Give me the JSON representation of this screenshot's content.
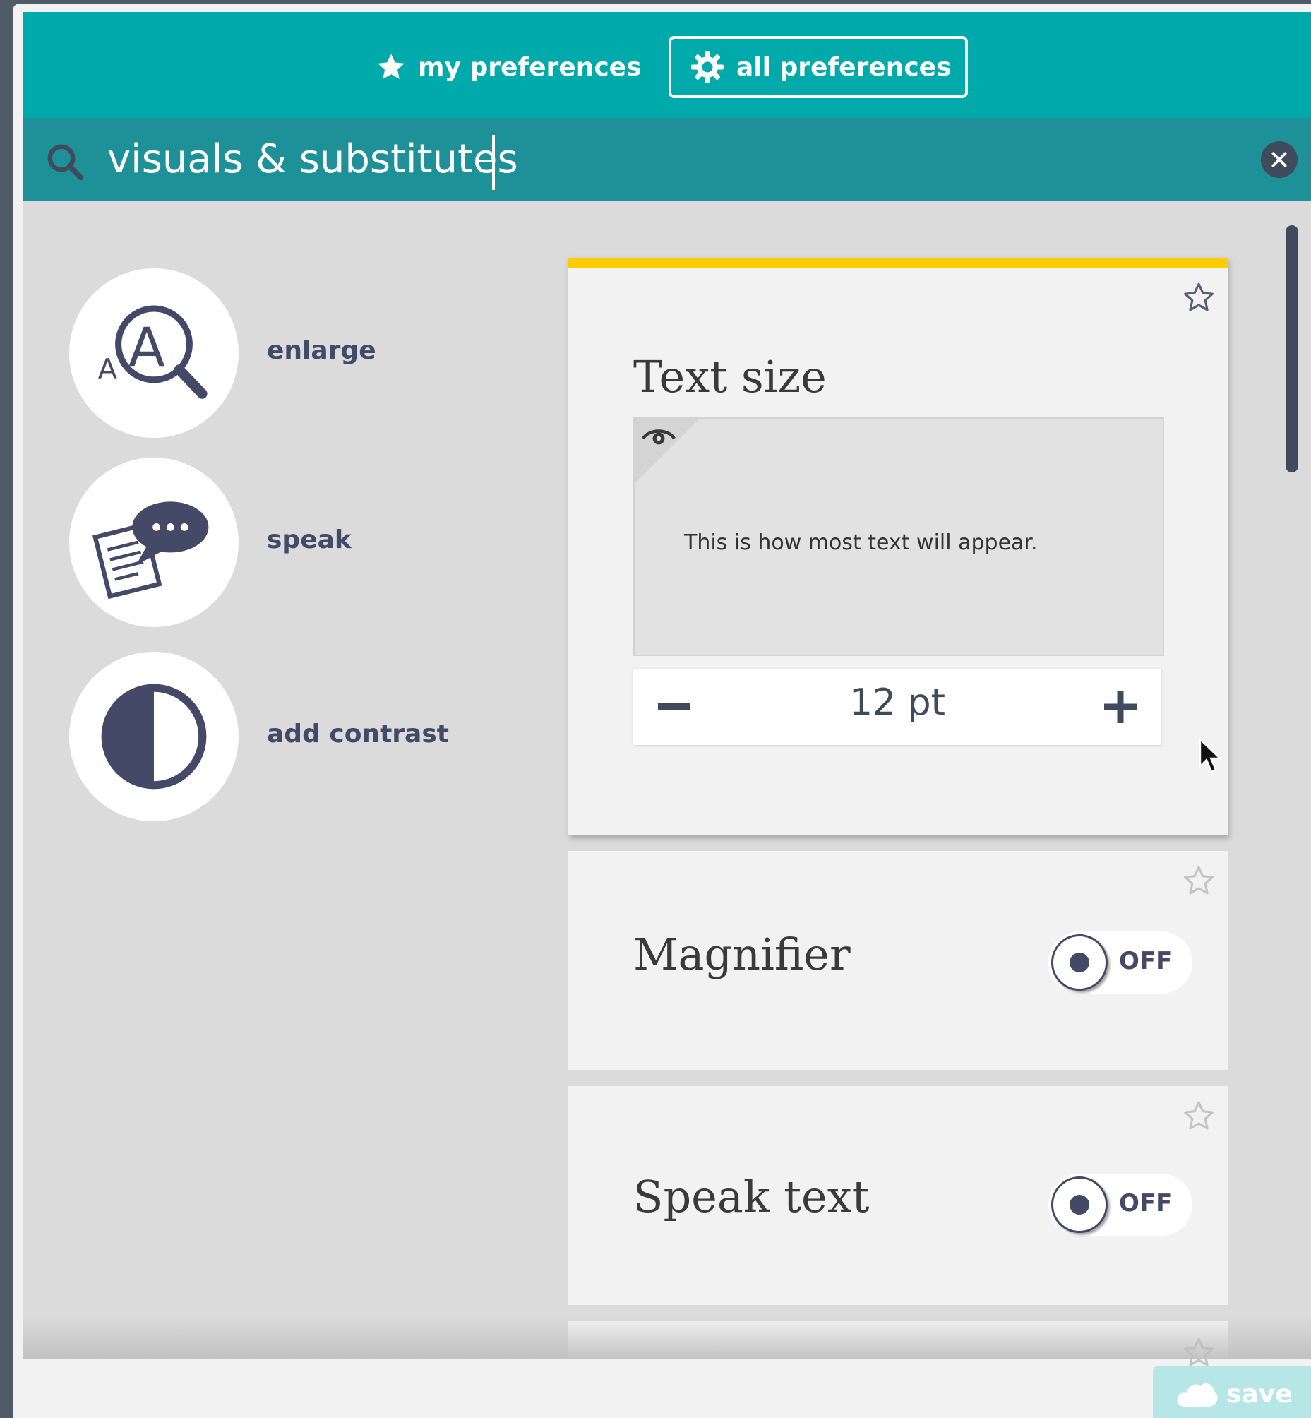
{
  "tabs": {
    "my_preferences": "my preferences",
    "all_preferences": "all preferences"
  },
  "search": {
    "value": "visuals & substitutes",
    "placeholder": ""
  },
  "categories": [
    {
      "label": "enlarge",
      "icon": "magnifier-text-icon"
    },
    {
      "label": "speak",
      "icon": "speech-bubble-document-icon"
    },
    {
      "label": "add contrast",
      "icon": "contrast-icon"
    }
  ],
  "cards": {
    "text_size": {
      "title": "Text size",
      "preview_text": "This is how most text will appear.",
      "value": "12 pt",
      "minus_glyph": "−",
      "plus_glyph": "+"
    },
    "magnifier": {
      "title": "Magnifier",
      "toggle_label": "OFF"
    },
    "speak_text": {
      "title": "Speak text",
      "toggle_label": "OFF"
    }
  },
  "footer": {
    "save_label": "save"
  },
  "colors": {
    "tab_bar": "#00aaab",
    "search_bar": "#1e9098",
    "accent_yellow": "#ffcc00",
    "dark_text": "#434966",
    "save_button": "#b7e6e6"
  }
}
